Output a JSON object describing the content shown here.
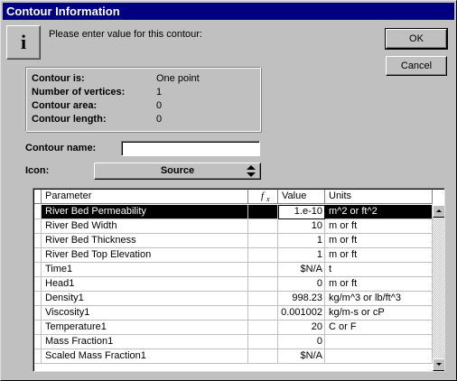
{
  "window": {
    "title": "Contour Information"
  },
  "prompt": {
    "text": "Please enter value for this contour:"
  },
  "buttons": {
    "ok": "OK",
    "cancel": "Cancel"
  },
  "info": {
    "rows": [
      {
        "label": "Contour is:",
        "value": "One point"
      },
      {
        "label": "Number of vertices:",
        "value": "1"
      },
      {
        "label": "Contour area:",
        "value": "0"
      },
      {
        "label": "Contour length:",
        "value": "0"
      }
    ]
  },
  "form": {
    "name_label": "Contour name:",
    "name_value": "",
    "icon_label": "Icon:",
    "icon_value": "Source"
  },
  "grid": {
    "headers": {
      "parameter": "Parameter",
      "fx": "fx",
      "value": "Value",
      "units": "Units"
    },
    "selected_row": 0,
    "rows": [
      {
        "parameter": "River Bed Permeability",
        "value": "1.e-10",
        "units": "m^2 or ft^2"
      },
      {
        "parameter": "River Bed Width",
        "value": "10",
        "units": "m or ft"
      },
      {
        "parameter": "River Bed Thickness",
        "value": "1",
        "units": "m or ft"
      },
      {
        "parameter": "River Bed Top Elevation",
        "value": "1",
        "units": "m or ft"
      },
      {
        "parameter": "Time1",
        "value": "$N/A",
        "units": "t"
      },
      {
        "parameter": "Head1",
        "value": "0",
        "units": "m or ft"
      },
      {
        "parameter": "Density1",
        "value": "998.23",
        "units": "kg/m^3 or lb/ft^3"
      },
      {
        "parameter": "Viscosity1",
        "value": "0.001002",
        "units": "kg/m-s or cP"
      },
      {
        "parameter": "Temperature1",
        "value": "20",
        "units": "C or F"
      },
      {
        "parameter": "Mass Fraction1",
        "value": "0",
        "units": ""
      },
      {
        "parameter": "Scaled Mass Fraction1",
        "value": "$N/A",
        "units": ""
      }
    ]
  },
  "icons": {
    "info": "info-icon",
    "fx": "function-icon",
    "select": "updown-arrows-icon"
  }
}
